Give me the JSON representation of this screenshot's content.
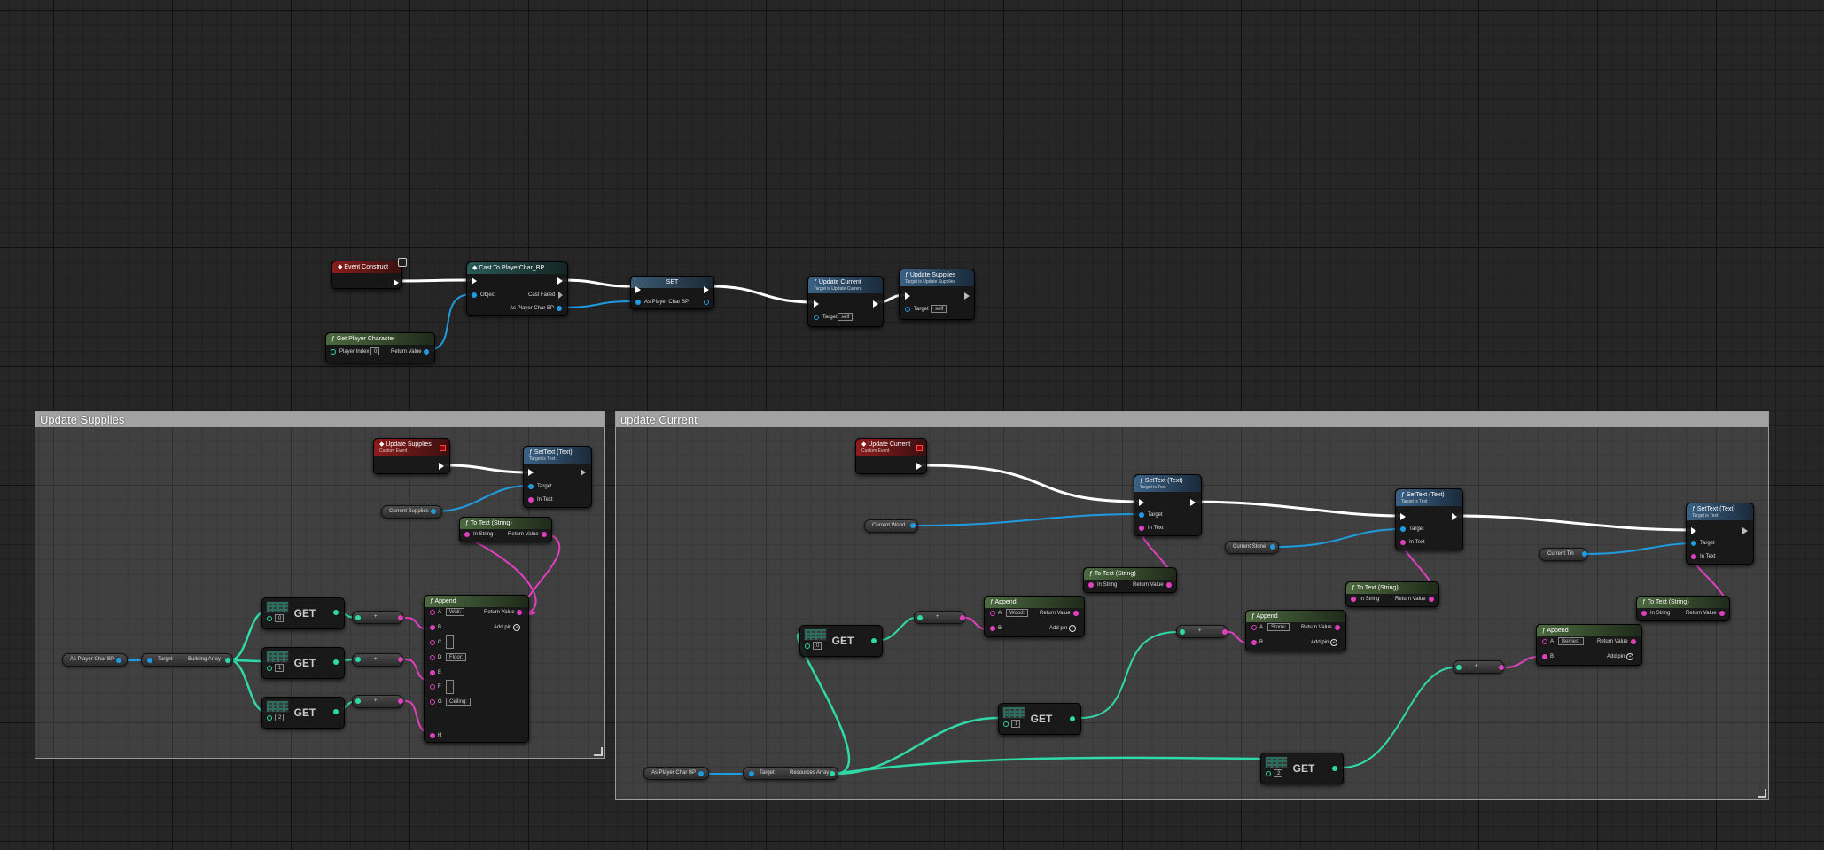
{
  "colors": {
    "exec": "#ffffff",
    "object": "#1f9be0",
    "text": "#e040c0",
    "array": "#2fd9a8",
    "event": "#8c1c1c",
    "function": "#3a6286",
    "pure": "#4c6a3f"
  },
  "comments": {
    "supplies": "Update Supplies",
    "current": "update Current"
  },
  "top": {
    "event_construct": "Event Construct",
    "cast_title": "Cast To PlayerChar_BP",
    "cast_object": "Object",
    "cast_failed": "Cast Failed",
    "cast_as": "As Player Char BP",
    "get_player": "Get Player Character",
    "player_index": "Player Index",
    "player_index_val": "0",
    "return_value": "Return Value",
    "set_title": "SET",
    "set_as": "As Player Char BP",
    "update_current": "Update Current",
    "update_current_sub": "Target is Update Current",
    "update_supplies": "Update Supplies",
    "update_supplies_sub": "Target is Update Supplies",
    "target": "Target",
    "self": "self"
  },
  "supplies": {
    "event_title": "Update Supplies",
    "event_sub": "Custom Event",
    "settext_title": "SetText (Text)",
    "settext_sub": "Target is Text",
    "target": "Target",
    "in_text": "In Text",
    "current_supplies": "Current Supplies",
    "totext_title": "To Text (String)",
    "in_string": "In String",
    "return_value": "Return Value",
    "as_player": "As Player Char BP",
    "building_target": "Target",
    "building_array": "Building Array",
    "get": "GET",
    "idx0": "0",
    "idx1": "1",
    "idx2": "2",
    "plus": "+",
    "append_title": "Append",
    "pins": [
      "A",
      "B",
      "C",
      "D",
      "E",
      "F",
      "G",
      "H"
    ],
    "val_a": "Wall:",
    "val_d": "Floor:",
    "val_g": "Ceiling:",
    "add_pin": "Add pin"
  },
  "current": {
    "event_title": "Update Current",
    "event_sub": "Custom Event",
    "settext_title": "SetText (Text)",
    "settext_sub": "Target is Text",
    "target": "Target",
    "in_text": "In Text",
    "current_wood": "Current Wood",
    "current_stone": "Current Stone",
    "current_tin": "Current Tin",
    "totext_title": "To Text (String)",
    "in_string": "In String",
    "return_value": "Return Value",
    "append_title": "Append",
    "pin_a": "A",
    "pin_b": "B",
    "wood": "Wood:",
    "stone": "Stone:",
    "berries": "Berries:",
    "add_pin": "Add pin",
    "get": "GET",
    "idx0": "0",
    "idx1": "1",
    "idx2": "2",
    "plus": "+",
    "as_player": "As Player Char BP",
    "resources_target": "Target",
    "resources_array": "Resources Array"
  }
}
